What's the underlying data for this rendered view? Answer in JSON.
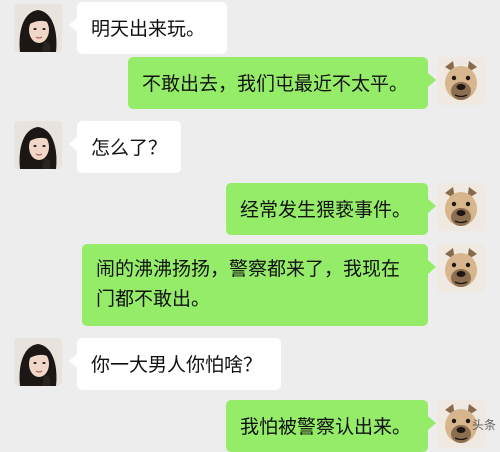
{
  "chat": {
    "messages": [
      {
        "sender": "girl",
        "text": "明天出来玩。"
      },
      {
        "sender": "dog",
        "text": "不敢出去，我们屯最近不太平。"
      },
      {
        "sender": "girl",
        "text": "怎么了？"
      },
      {
        "sender": "dog",
        "text": "经常发生猥亵事件。"
      },
      {
        "sender": "dog",
        "text": "闹的沸沸扬扬，警察都来了，我现在门都不敢出。"
      },
      {
        "sender": "girl",
        "text": "你一大男人你怕啥？"
      },
      {
        "sender": "dog",
        "text": "我怕被警察认出来。"
      }
    ]
  },
  "colors": {
    "background": "#ededed",
    "incoming_bubble": "#ffffff",
    "outgoing_bubble": "#95ec69"
  },
  "icons": {
    "girl_avatar": "woman-avatar-icon",
    "dog_avatar": "dog-avatar-icon"
  },
  "watermark": "头条"
}
